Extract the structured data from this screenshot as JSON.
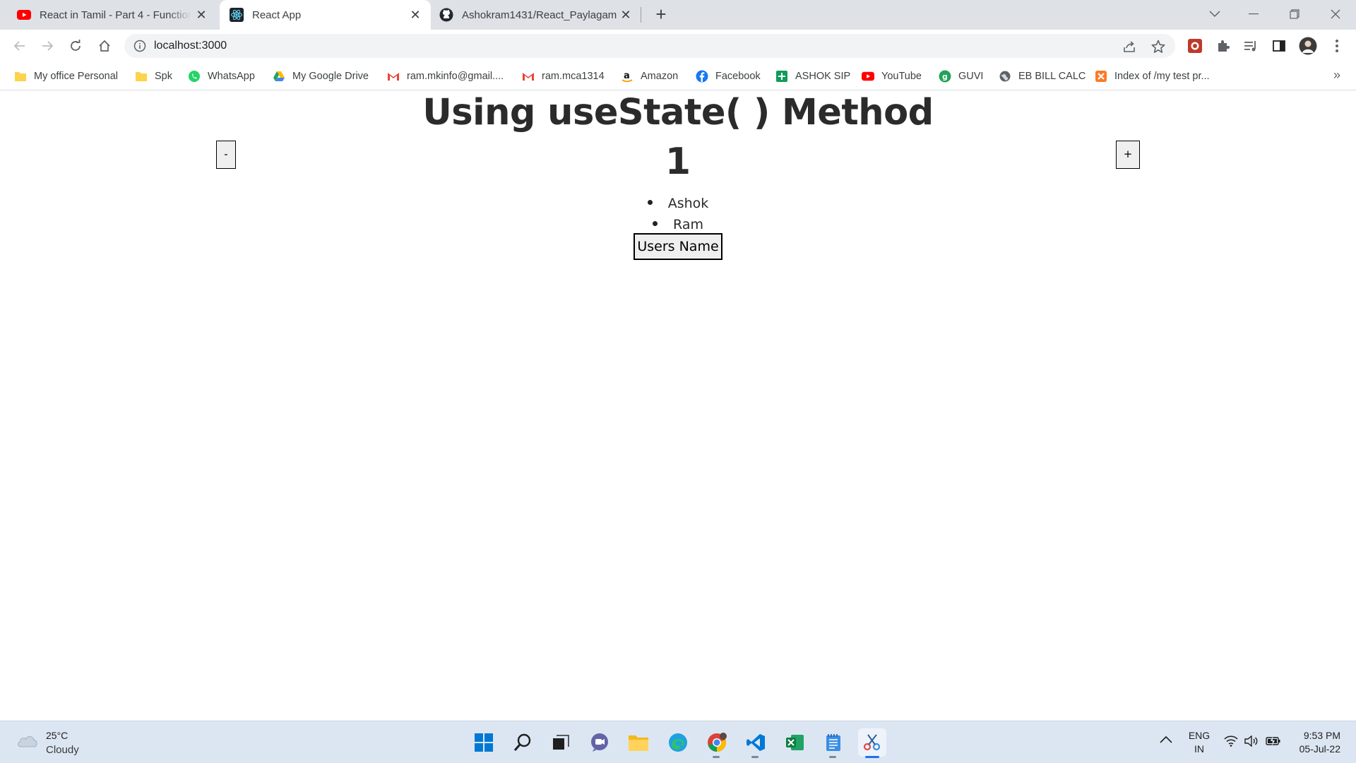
{
  "browser": {
    "tabs": [
      {
        "title": "React in Tamil - Part 4 - Function",
        "icon": "youtube-icon",
        "active": false
      },
      {
        "title": "React App",
        "icon": "react-icon",
        "active": true
      },
      {
        "title": "Ashokram1431/React_Paylagam",
        "icon": "github-icon",
        "active": false
      }
    ],
    "new_tab_label": "+",
    "close_glyph": "✕",
    "url": "localhost:3000",
    "bookmarks": [
      {
        "label": "My office Personal",
        "icon": "folder-icon"
      },
      {
        "label": "Spk",
        "icon": "folder-icon"
      },
      {
        "label": "WhatsApp",
        "icon": "whatsapp-icon"
      },
      {
        "label": "My Google Drive",
        "icon": "google-drive-icon"
      },
      {
        "label": "ram.mkinfo@gmail....",
        "icon": "gmail-icon"
      },
      {
        "label": "ram.mca1314",
        "icon": "gmail-icon"
      },
      {
        "label": "Amazon",
        "icon": "amazon-icon"
      },
      {
        "label": "Facebook",
        "icon": "facebook-icon"
      },
      {
        "label": "ASHOK SIP",
        "icon": "sheets-icon"
      },
      {
        "label": "YouTube",
        "icon": "youtube-icon"
      },
      {
        "label": "GUVI",
        "icon": "guvi-icon"
      },
      {
        "label": "EB BILL CALC",
        "icon": "globe-icon"
      },
      {
        "label": "Index of /my test pr...",
        "icon": "xampp-icon"
      }
    ],
    "bookmarks_overflow": "»"
  },
  "app": {
    "heading": "Using useState( ) Method",
    "count": "1",
    "decrement_label": "-",
    "increment_label": "+",
    "users": [
      "Ashok",
      "Ram"
    ],
    "users_button_label": "Users Name"
  },
  "taskbar": {
    "weather": {
      "temp": "25°C",
      "condition": "Cloudy"
    },
    "apps": [
      "start-icon",
      "search-icon",
      "task-view-icon",
      "chat-icon",
      "file-explorer-icon",
      "edge-icon",
      "chrome-icon",
      "vscode-icon",
      "excel-icon",
      "notepad-icon",
      "snipping-tool-icon"
    ],
    "language": {
      "line1": "ENG",
      "line2": "IN"
    },
    "time": "9:53 PM",
    "date": "05-Jul-22"
  },
  "colors": {
    "tab_strip": "#dee1e6",
    "taskbar": "#dce6f2",
    "youtube_red": "#ff0000",
    "accent_blue": "#1a73e8"
  }
}
